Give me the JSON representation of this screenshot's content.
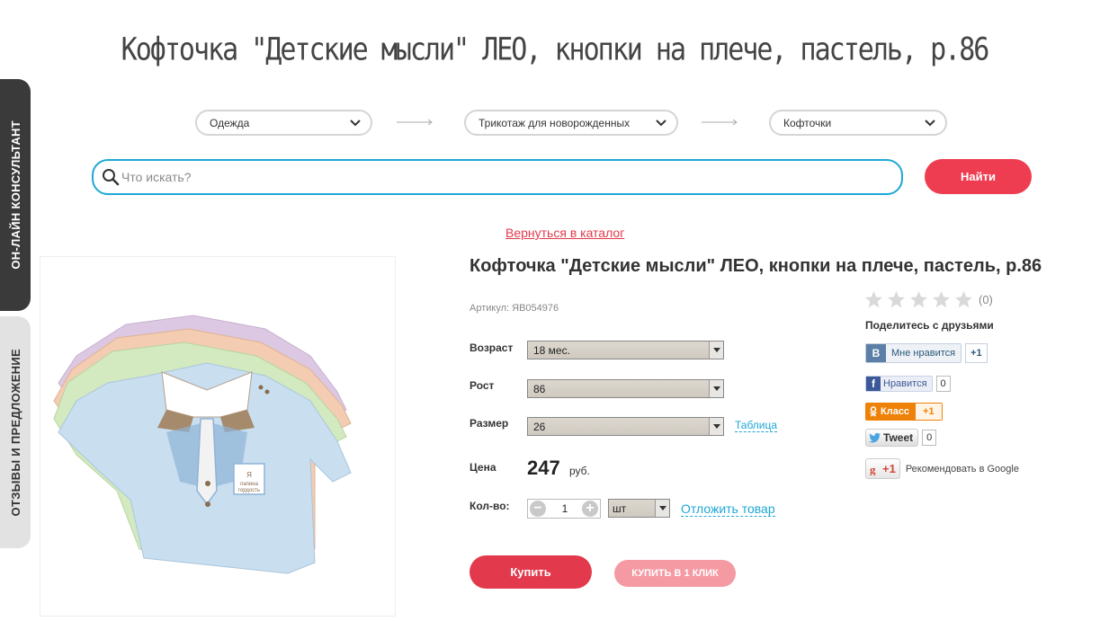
{
  "side_tabs": {
    "consultant": "ОН-ЛАЙН КОНСУЛЬТАНТ",
    "reviews": "ОТЗЫВЫ И ПРЕДЛОЖЕНИЕ"
  },
  "page_title": "Кофточка \"Детские мысли\" ЛЕО, кнопки на плече, пастель, р.86",
  "categories": {
    "level1": "Одежда",
    "level2": "Трикотаж для новорожденных",
    "level3": "Кофточки"
  },
  "search": {
    "placeholder": "Что искать?",
    "button_label": "Найти"
  },
  "back_link": "Вернуться в каталог",
  "product": {
    "name": "Кофточка \"Детские мысли\" ЛЕО, кнопки на плече, пастель, р.86",
    "sku": "Артикул: ЯВ054976",
    "print_text": "Я папина гордость",
    "options": {
      "age_label": "Возраст",
      "age_value": "18 мес.",
      "height_label": "Рост",
      "height_value": "86",
      "size_label": "Размер",
      "size_value": "26",
      "size_table_link": "Таблица"
    },
    "price_label": "Цена",
    "price_value": "247",
    "price_currency": "руб.",
    "qty_label": "Кол-во:",
    "qty_minus": "−",
    "qty_plus": "+",
    "qty_value": "1",
    "unit_value": "шт",
    "defer_link": "Отложить товар",
    "buy_button": "Купить",
    "oneclick_button": "КУПИТЬ В 1 КЛИК"
  },
  "rating": {
    "stars_filled": 0,
    "stars_total": 5,
    "count": "(0)"
  },
  "share": {
    "title": "Поделитесь с друзьями",
    "vk_logo": "В",
    "vk_label": "Мне нравится",
    "vk_count": "+1",
    "fb_logo": "f",
    "fb_label": "Нравится",
    "fb_count": "0",
    "ok_label": "Класс",
    "ok_count": "+1",
    "tw_label": "Tweet",
    "tw_count": "0",
    "gp_label": "+1",
    "gp_recommend": "Рекомендовать в Google"
  },
  "colors": {
    "accent_red": "#e23a4c",
    "search_blue": "#1ea7d6",
    "dark_tab": "#3a3a3a"
  }
}
